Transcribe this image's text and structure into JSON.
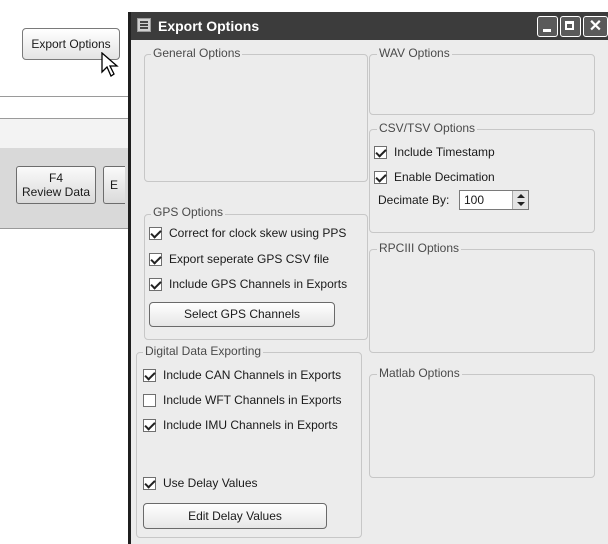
{
  "background_app": {
    "export_button": "Export Options",
    "f4_key": "F4",
    "f4_label": "Review Data",
    "partial_button": "E"
  },
  "dialog": {
    "title": "Export Options",
    "close_glyph": "✕",
    "general": {
      "label": "General Options"
    },
    "gps": {
      "label": "GPS Options",
      "options": [
        {
          "label": "Correct for clock skew using PPS",
          "checked": true
        },
        {
          "label": "Export seperate GPS CSV file",
          "checked": true
        },
        {
          "label": "Include GPS Channels in Exports",
          "checked": true
        }
      ],
      "button": "Select GPS Channels"
    },
    "digital": {
      "label": "Digital Data Exporting",
      "options": [
        {
          "label": "Include CAN Channels in Exports",
          "checked": true
        },
        {
          "label": "Include WFT Channels in Exports",
          "checked": false
        },
        {
          "label": "Include IMU Channels in Exports",
          "checked": true
        }
      ],
      "delay": {
        "label": "Use Delay Values",
        "checked": true
      },
      "button": "Edit Delay Values"
    },
    "wav": {
      "label": "WAV Options"
    },
    "csv": {
      "label": "CSV/TSV Options",
      "options": [
        {
          "label": "Include Timestamp",
          "checked": true
        },
        {
          "label": "Enable Decimation",
          "checked": true
        }
      ],
      "decimate_label": "Decimate By:",
      "decimate_value": "100"
    },
    "rpc": {
      "label": "RPCIII Options"
    },
    "matlab": {
      "label": "Matlab Options"
    }
  }
}
